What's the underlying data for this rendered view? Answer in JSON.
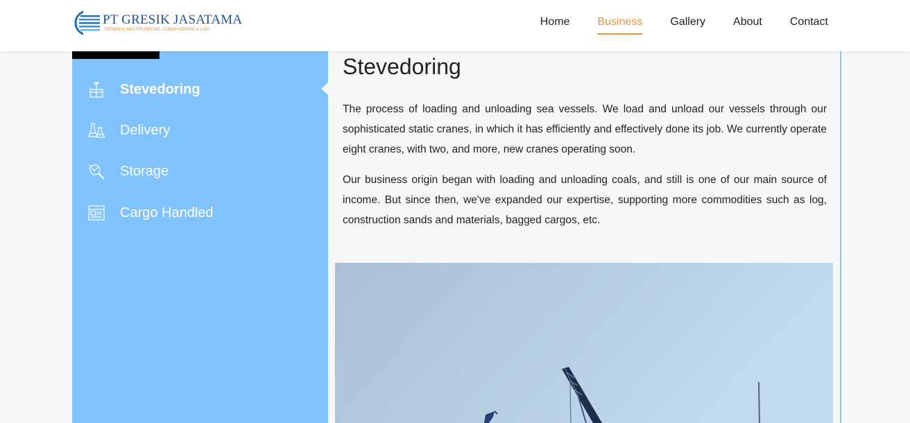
{
  "header": {
    "logo": {
      "title": "PT GRESIK JASATAMA",
      "subtitle": "TERMINAL MULTIPURPOSE, CURAH KERING & LOG"
    },
    "nav": [
      {
        "label": "Home",
        "active": false
      },
      {
        "label": "Business",
        "active": true
      },
      {
        "label": "Gallery",
        "active": false
      },
      {
        "label": "About",
        "active": false
      },
      {
        "label": "Contact",
        "active": false
      }
    ]
  },
  "sidebar": {
    "items": [
      {
        "label": "Stevedoring",
        "icon": "crane-box-icon",
        "active": true
      },
      {
        "label": "Delivery",
        "icon": "flask-icon",
        "active": false
      },
      {
        "label": "Storage",
        "icon": "magnifier-icon",
        "active": false
      },
      {
        "label": "Cargo Handled",
        "icon": "cargo-doc-icon",
        "active": false
      }
    ]
  },
  "main": {
    "title": "Stevedoring",
    "paragraphs": [
      "The process of loading and unloading sea vessels. We load and unload our vessels through our sophisticated static cranes, in which it has efficiently and effectively done its job. We currently operate eight cranes, with two, and more, new cranes operating soon.",
      "Our business origin began with loading and unloading coals, and still is one of our main source of income. But since then, we've expanded our expertise, supporting more commodities such as log, construction sands and materials, bagged cargos, etc."
    ]
  },
  "colors": {
    "accent": "#e8953a",
    "sidebar": "#80c3fc",
    "brand": "#1f4f95"
  }
}
